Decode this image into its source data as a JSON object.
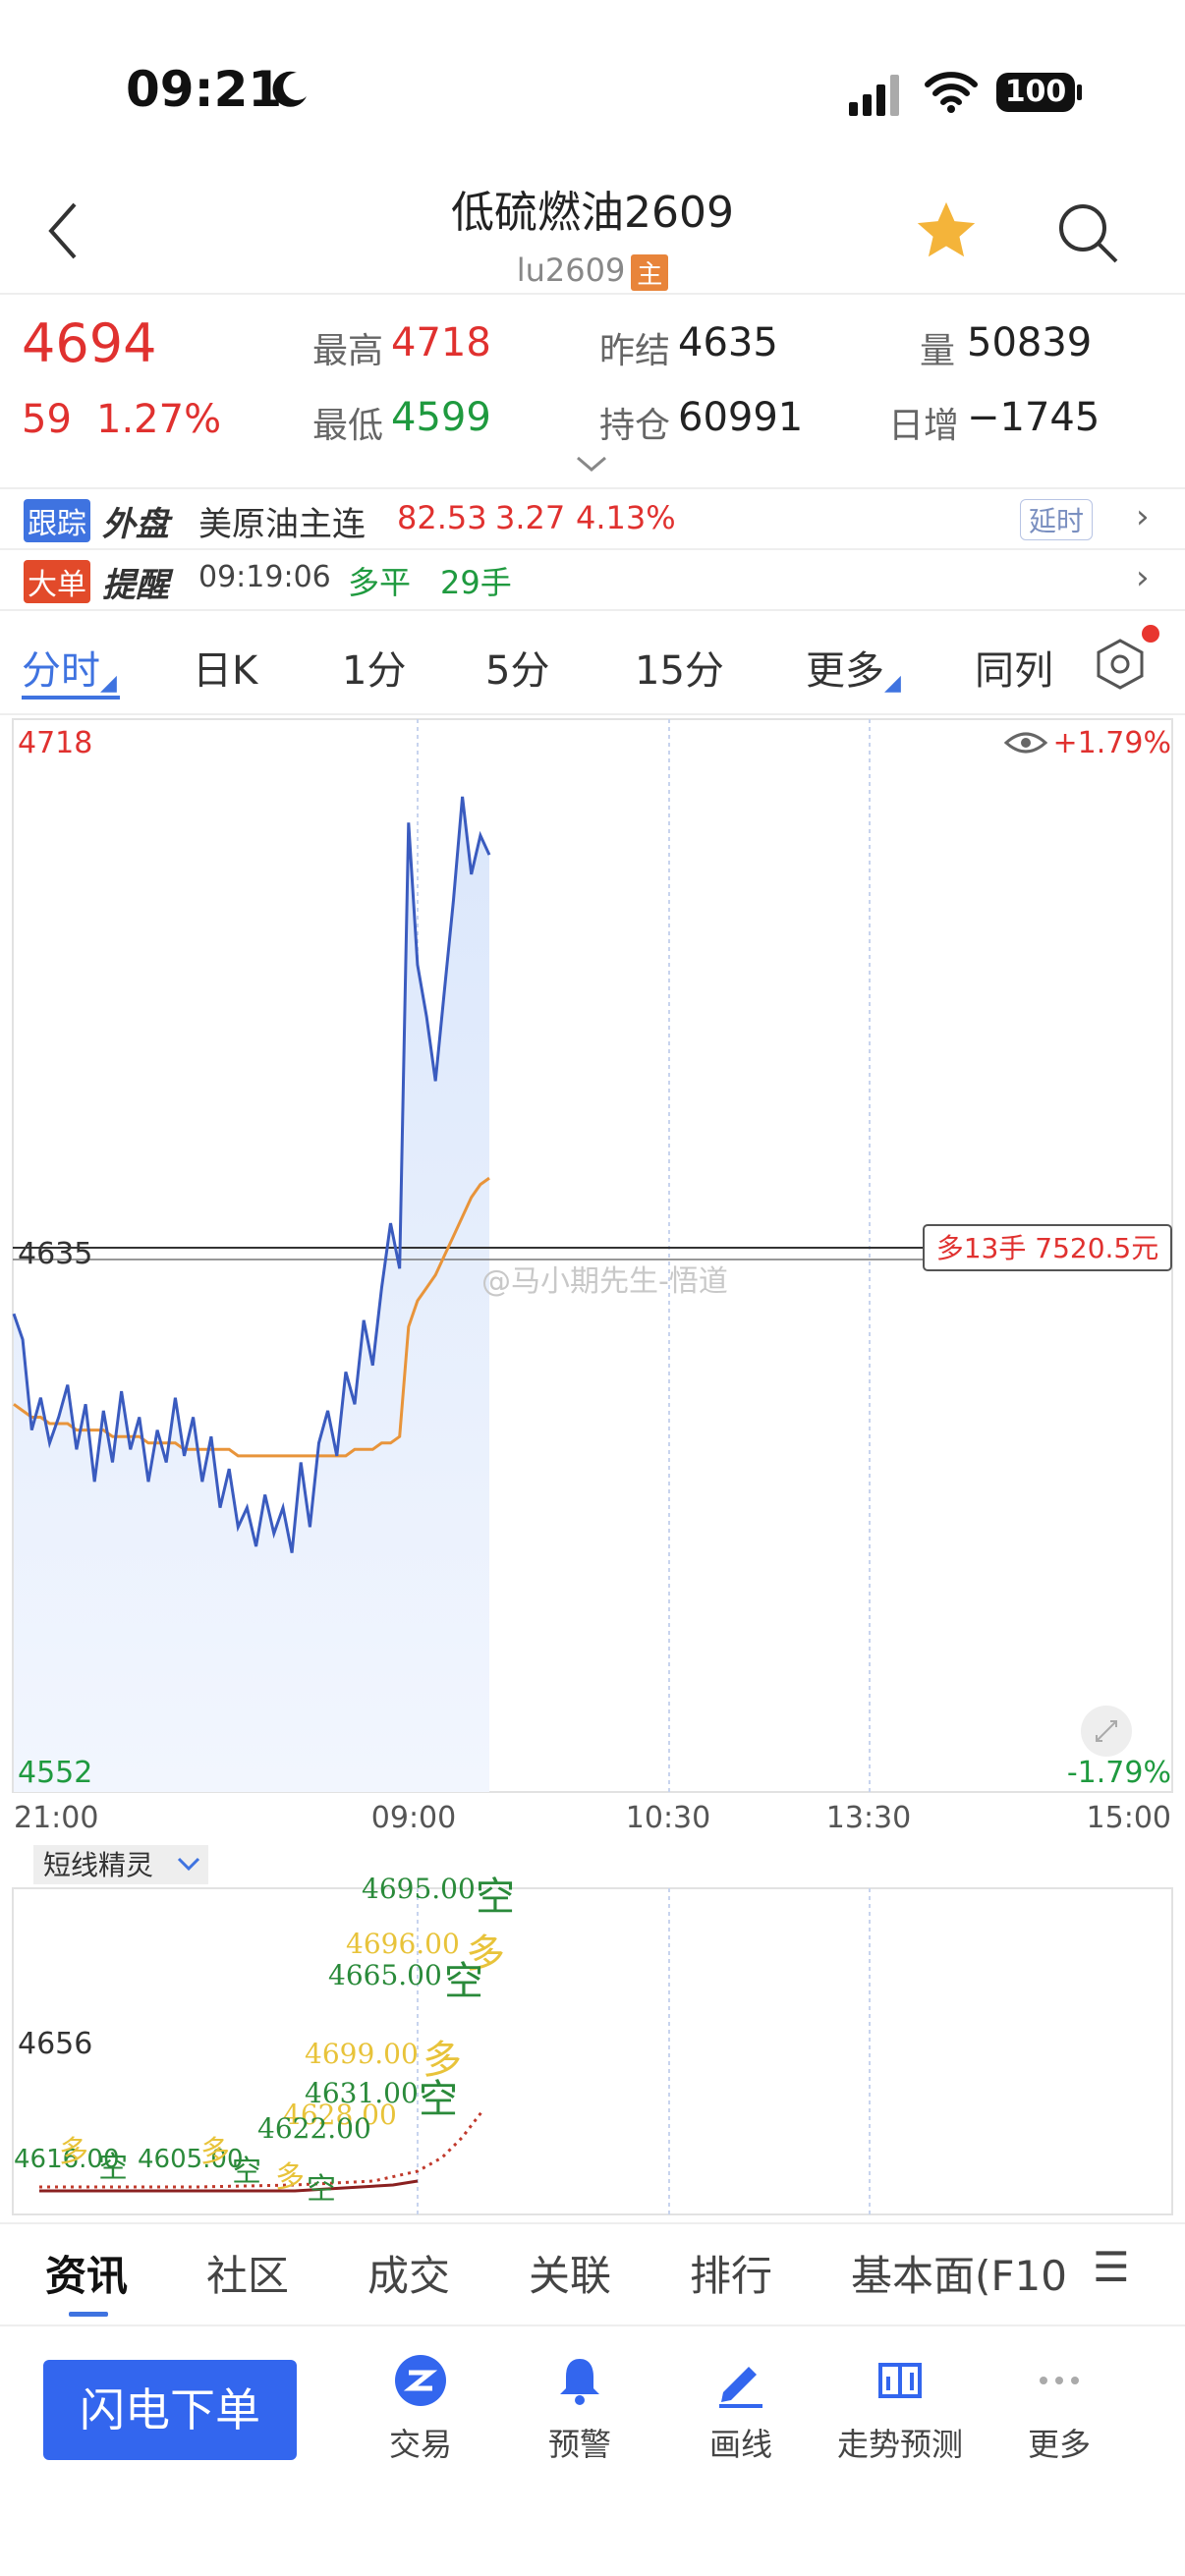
{
  "status": {
    "time": "09:21",
    "battery": "100"
  },
  "header": {
    "title": "低硫燃油2609",
    "code": "lu2609",
    "main_badge": "主"
  },
  "quote": {
    "price": "4694",
    "change": "59",
    "change_pct": "1.27%",
    "high_label": "最高",
    "high": "4718",
    "low_label": "最低",
    "low": "4599",
    "prev_settle_label": "昨结",
    "prev_settle": "4635",
    "open_interest_label": "持仓",
    "open_interest": "60991",
    "volume_label": "量",
    "volume": "50839",
    "daily_change_label": "日增",
    "daily_change": "−1745"
  },
  "foreign": {
    "tag1": "跟踪",
    "tag2": "外盘",
    "name": "美原油主连",
    "price": "82.53",
    "change": "3.27",
    "pct": "4.13%",
    "delay_label": "延时"
  },
  "alert": {
    "tag1": "大单",
    "tag2": "提醒",
    "time": "09:19:06",
    "type": "多平",
    "qty": "29手"
  },
  "tabs": [
    "分时",
    "日K",
    "1分",
    "5分",
    "15分",
    "更多",
    "同列"
  ],
  "chart": {
    "y_top": "4718",
    "y_mid": "4635",
    "y_bottom": "4552",
    "pct_top": "+1.79%",
    "pct_bottom": "-1.79%",
    "times": [
      "21:00",
      "09:00",
      "10:30",
      "13:30",
      "15:00"
    ],
    "order_tag": "多13手 7520.5元",
    "watermark": "@马小期先生-悟道",
    "sub_indicator": "短线精灵",
    "sub_y": "4656",
    "sub_labels": [
      {
        "text": "4695.00",
        "color": "#2a8a3a"
      },
      {
        "text": "空",
        "color": "#2a8a3a"
      },
      {
        "text": "4696.00",
        "color": "#e8c33a"
      },
      {
        "text": "多",
        "color": "#e8c33a"
      },
      {
        "text": "4665.00",
        "color": "#2a8a3a"
      },
      {
        "text": "空",
        "color": "#2a8a3a"
      },
      {
        "text": "4699.00",
        "color": "#e8c33a"
      },
      {
        "text": "多",
        "color": "#e8c33a"
      },
      {
        "text": "4631.00",
        "color": "#2a8a3a"
      },
      {
        "text": "空",
        "color": "#2a8a3a"
      },
      {
        "text": "4628.00",
        "color": "#e8c33a"
      },
      {
        "text": "4622.00",
        "color": "#2a8a3a"
      }
    ]
  },
  "bottom_tabs": [
    "资讯",
    "社区",
    "成交",
    "关联",
    "排行",
    "基本面(F10",
    "☰"
  ],
  "actions": {
    "order_button": "闪电下单",
    "items": [
      "交易",
      "预警",
      "画线",
      "走势预测",
      "更多"
    ]
  },
  "colors": {
    "up": "#e0312f",
    "down": "#1f9a3f",
    "accent": "#3366ee",
    "price_line": "#3a5bbf",
    "avg_line": "#e8943a"
  }
}
